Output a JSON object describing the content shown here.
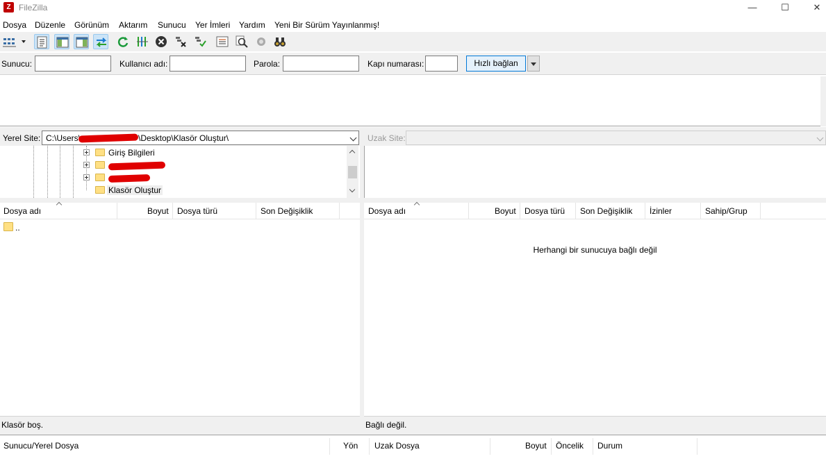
{
  "window": {
    "title": "FileZilla",
    "app_icon_letter": "Z",
    "minimize": "—",
    "maximize": "☐",
    "close": "✕"
  },
  "menu": {
    "items": [
      "Dosya",
      "Düzenle",
      "Görünüm",
      "Aktarım",
      "Sunucu",
      "Yer İmleri",
      "Yardım",
      "Yeni Bir Sürüm Yayınlanmış!"
    ]
  },
  "toolbar": {
    "buttons": [
      "site-manager",
      "toggle-message-log",
      "toggle-local-tree",
      "toggle-remote-tree",
      "toggle-transfer-queue",
      "refresh",
      "process-queue",
      "cancel",
      "disconnect",
      "reconnect",
      "directory-listing-filters",
      "toggle-filename-filters",
      "search-remote",
      "compare-directories"
    ]
  },
  "quickconnect": {
    "host_label": "Sunucu:",
    "host_value": "",
    "user_label": "Kullanıcı adı:",
    "user_value": "",
    "password_label": "Parola:",
    "password_value": "",
    "port_label": "Kapı numarası:",
    "port_value": "",
    "connect_label": "Hızlı bağlan"
  },
  "local": {
    "site_label": "Yerel Site:",
    "path_prefix": "C:\\Users\\",
    "path_suffix": "\\Desktop\\Klasör Oluştur\\",
    "tree": [
      {
        "label": "Giriş Bilgileri",
        "expandable": true
      },
      {
        "label": "",
        "expandable": true,
        "redacted": true
      },
      {
        "label": "",
        "expandable": true,
        "redacted": true
      },
      {
        "label": "Klasör Oluştur",
        "expandable": false,
        "selected": true
      }
    ],
    "columns": [
      "Dosya adı",
      "Boyut",
      "Dosya türü",
      "Son Değişiklik"
    ],
    "rows": [
      {
        "name": ".."
      }
    ],
    "status": "Klasör boş."
  },
  "remote": {
    "site_label": "Uzak Site:",
    "path": "",
    "columns": [
      "Dosya adı",
      "Boyut",
      "Dosya türü",
      "Son Değişiklik",
      "İzinler",
      "Sahip/Grup"
    ],
    "empty_message": "Herhangi bir sunucuya bağlı değil",
    "status": "Bağlı değil."
  },
  "queue": {
    "columns": [
      "Sunucu/Yerel Dosya",
      "Yön",
      "Uzak Dosya",
      "Boyut",
      "Öncelik",
      "Durum"
    ]
  },
  "colors": {
    "accent": "#0078d7",
    "redaction": "#e00000",
    "folder": "#ffe084"
  }
}
